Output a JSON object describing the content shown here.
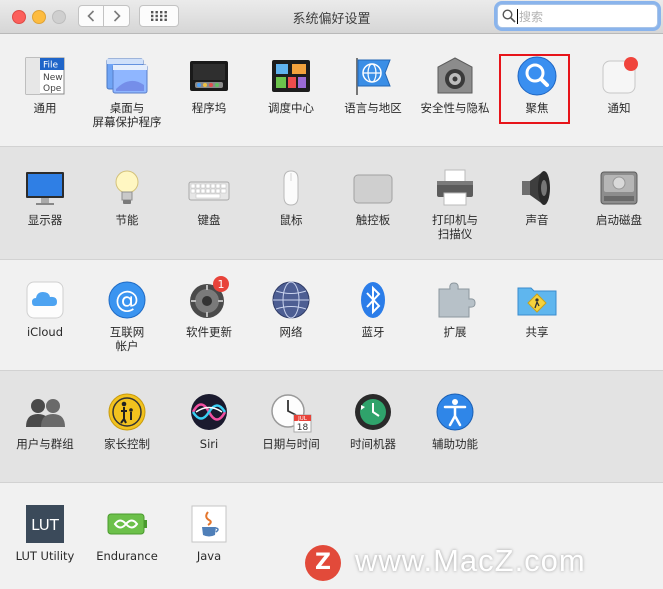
{
  "window": {
    "title": "系统偏好设置"
  },
  "search": {
    "placeholder": "搜索"
  },
  "rows": [
    [
      {
        "label": "通用",
        "icon": "general-icon"
      },
      {
        "label": "桌面与\n屏幕保护程序",
        "icon": "desktop-screensaver-icon"
      },
      {
        "label": "程序坞",
        "icon": "dock-icon"
      },
      {
        "label": "调度中心",
        "icon": "mission-control-icon"
      },
      {
        "label": "语言与地区",
        "icon": "language-region-icon"
      },
      {
        "label": "安全性与隐私",
        "icon": "security-privacy-icon"
      },
      {
        "label": "聚焦",
        "icon": "spotlight-icon"
      },
      {
        "label": "通知",
        "icon": "notifications-icon"
      }
    ],
    [
      {
        "label": "显示器",
        "icon": "displays-icon"
      },
      {
        "label": "节能",
        "icon": "energy-saver-icon"
      },
      {
        "label": "键盘",
        "icon": "keyboard-icon"
      },
      {
        "label": "鼠标",
        "icon": "mouse-icon"
      },
      {
        "label": "触控板",
        "icon": "trackpad-icon"
      },
      {
        "label": "打印机与\n扫描仪",
        "icon": "printers-scanners-icon"
      },
      {
        "label": "声音",
        "icon": "sound-icon"
      },
      {
        "label": "启动磁盘",
        "icon": "startup-disk-icon"
      }
    ],
    [
      {
        "label": "iCloud",
        "icon": "icloud-icon"
      },
      {
        "label": "互联网\n帐户",
        "icon": "internet-accounts-icon"
      },
      {
        "label": "软件更新",
        "icon": "software-update-icon",
        "badge": "1"
      },
      {
        "label": "网络",
        "icon": "network-icon"
      },
      {
        "label": "蓝牙",
        "icon": "bluetooth-icon"
      },
      {
        "label": "扩展",
        "icon": "extensions-icon"
      },
      {
        "label": "共享",
        "icon": "sharing-icon"
      }
    ],
    [
      {
        "label": "用户与群组",
        "icon": "users-groups-icon"
      },
      {
        "label": "家长控制",
        "icon": "parental-controls-icon"
      },
      {
        "label": "Siri",
        "icon": "siri-icon"
      },
      {
        "label": "日期与时间",
        "icon": "date-time-icon",
        "cal_month": "JUL",
        "cal_day": "18"
      },
      {
        "label": "时间机器",
        "icon": "time-machine-icon"
      },
      {
        "label": "辅助功能",
        "icon": "accessibility-icon"
      }
    ],
    [
      {
        "label": "LUT Utility",
        "icon": "lut-utility-icon",
        "icon_text": "LUT"
      },
      {
        "label": "Endurance",
        "icon": "endurance-icon"
      },
      {
        "label": "Java",
        "icon": "java-icon"
      }
    ]
  ],
  "general_icon_text": [
    "File",
    "New",
    "Ope"
  ],
  "watermark": {
    "badge": "Z",
    "text": "www.MacZ.com"
  },
  "colors": {
    "accent": "#1a82fb",
    "highlight": "#e7141a"
  }
}
